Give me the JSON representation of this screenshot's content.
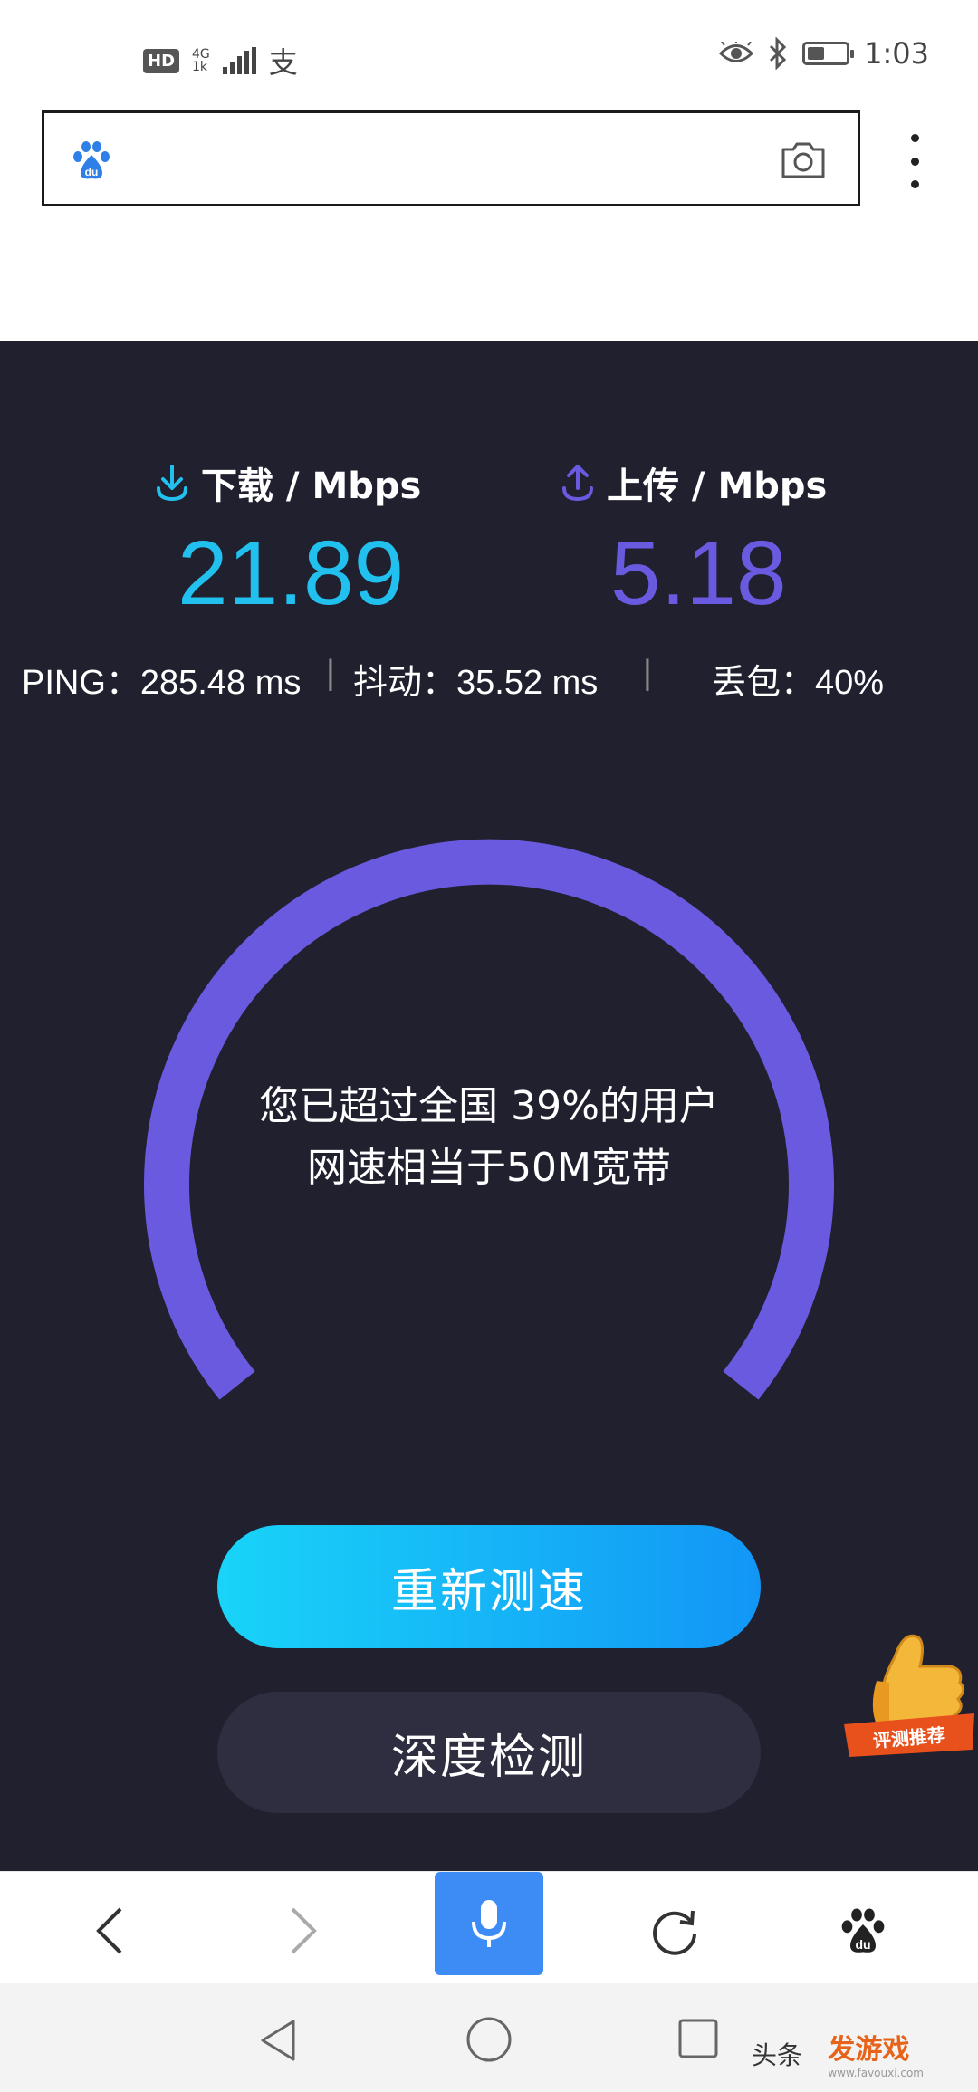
{
  "status_bar": {
    "hd": "HD",
    "network": "4G",
    "network_sub": "1k",
    "time": "1:03",
    "battery_level": 0.45
  },
  "address_bar": {
    "logo_text": "du"
  },
  "speed": {
    "download_label": "下载 / Mbps",
    "download_value": "21.89",
    "upload_label": "上传 / Mbps",
    "upload_value": "5.18",
    "ping": "PING：285.48 ms",
    "jitter": "抖动：35.52 ms",
    "loss": "丢包：40%",
    "result_line1": "您已超过全国 39%的用户",
    "result_line2": "网速相当于50M宽带",
    "retest_label": "重新测速",
    "deep_label": "深度检测",
    "badge_text": "评测推荐",
    "colors": {
      "download": "#22c0ee",
      "upload": "#6a5ae0",
      "gauge": "#6a5ae0",
      "panel_bg": "#20202f"
    }
  },
  "toolbar": {
    "baidu_text": "du"
  },
  "watermark": {
    "left_text": "头条",
    "main": "发游戏",
    "url": "www.favouxi.com"
  }
}
